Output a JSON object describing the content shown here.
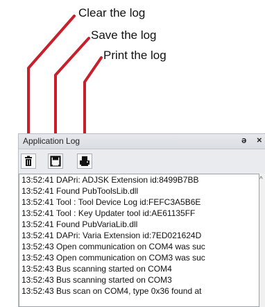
{
  "callouts": {
    "clear": "Clear the log",
    "save": "Save the log",
    "print": "Print the log"
  },
  "panel": {
    "title": "Application Log",
    "pin_glyph": "ə",
    "close_glyph": "×"
  },
  "toolbar": {
    "buttons": [
      {
        "icon": "trash-icon",
        "action": "clear"
      },
      {
        "icon": "save-icon",
        "action": "save"
      },
      {
        "icon": "print-icon",
        "action": "print"
      }
    ]
  },
  "log": {
    "lines": [
      "13:52:41  DAPri: ADJSK Extension id:8499B7BB",
      "13:52:41 Found PubToolsLib.dll",
      "13:52:41  Tool : Tool Device Log id:FEFC3A5B6E",
      "13:52:41  Tool : Key Updater tool id:AE61135FF",
      "13:52:41 Found PubVariaLib.dll",
      "13:52:41  DAPri: Varia Extension id:7ED021624D",
      "13:52:43 Open communication on COM4 was suc",
      "13:52:43 Open communication on COM3 was suc",
      "13:52:43 Bus scanning started on COM4",
      "13:52:43 Bus scanning started on COM3",
      "13:52:43 Bus scan on COM4, type 0x36 found at"
    ]
  },
  "colors": {
    "arrow": "#c8202a"
  }
}
